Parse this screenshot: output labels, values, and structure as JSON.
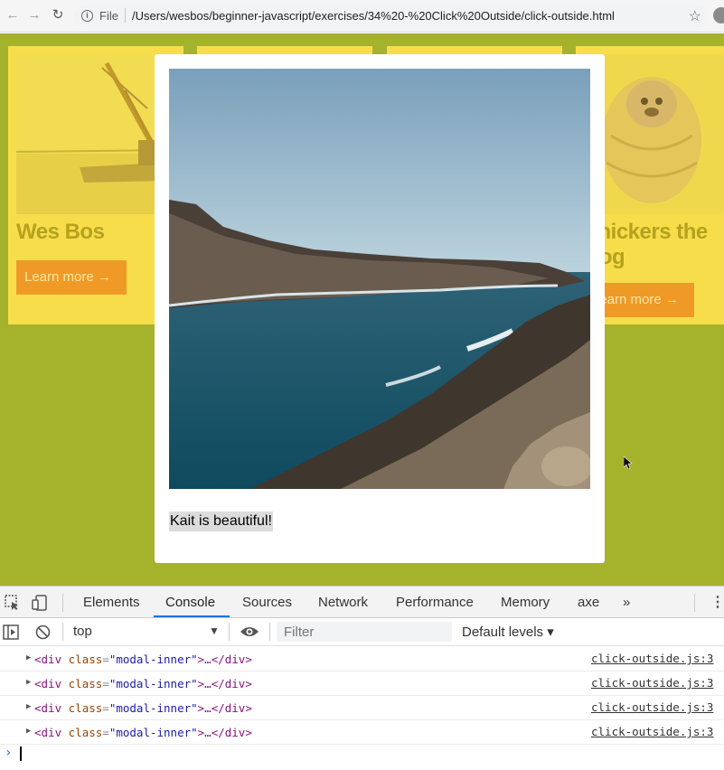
{
  "browser": {
    "file_label": "File",
    "url": "/Users/wesbos/beginner-javascript/exercises/34%20-%20Click%20Outside/click-outside.html"
  },
  "cards": [
    {
      "title": "Wes Bos",
      "button": "Learn more →"
    },
    {
      "title": "",
      "button": ""
    },
    {
      "title": "",
      "button": ""
    },
    {
      "title": "Snickers the Dog",
      "button": "Learn more →"
    }
  ],
  "modal": {
    "caption": "Kait is beautiful!"
  },
  "devtools": {
    "tabs": [
      "Elements",
      "Console",
      "Sources",
      "Network",
      "Performance",
      "Memory",
      "axe"
    ],
    "active_tab": "Console",
    "more": "»",
    "context": "top",
    "filter_placeholder": "Filter",
    "levels": "Default levels ▾",
    "rows": [
      {
        "tag_open": "<div",
        "attr": "class",
        "value": "\"modal-inner\"",
        "rest": ">…</div>",
        "source": "click-outside.js:3"
      },
      {
        "tag_open": "<div",
        "attr": "class",
        "value": "\"modal-inner\"",
        "rest": ">…</div>",
        "source": "click-outside.js:3"
      },
      {
        "tag_open": "<div",
        "attr": "class",
        "value": "\"modal-inner\"",
        "rest": ">…</div>",
        "source": "click-outside.js:3"
      },
      {
        "tag_open": "<div",
        "attr": "class",
        "value": "\"modal-inner\"",
        "rest": ">…</div>",
        "source": "click-outside.js:3"
      }
    ]
  },
  "colors": {
    "page_bg": "#a5b22c",
    "card_bg": "#f7dd4a",
    "button_bg": "#ef9a26",
    "accent": "#1a73e8"
  }
}
